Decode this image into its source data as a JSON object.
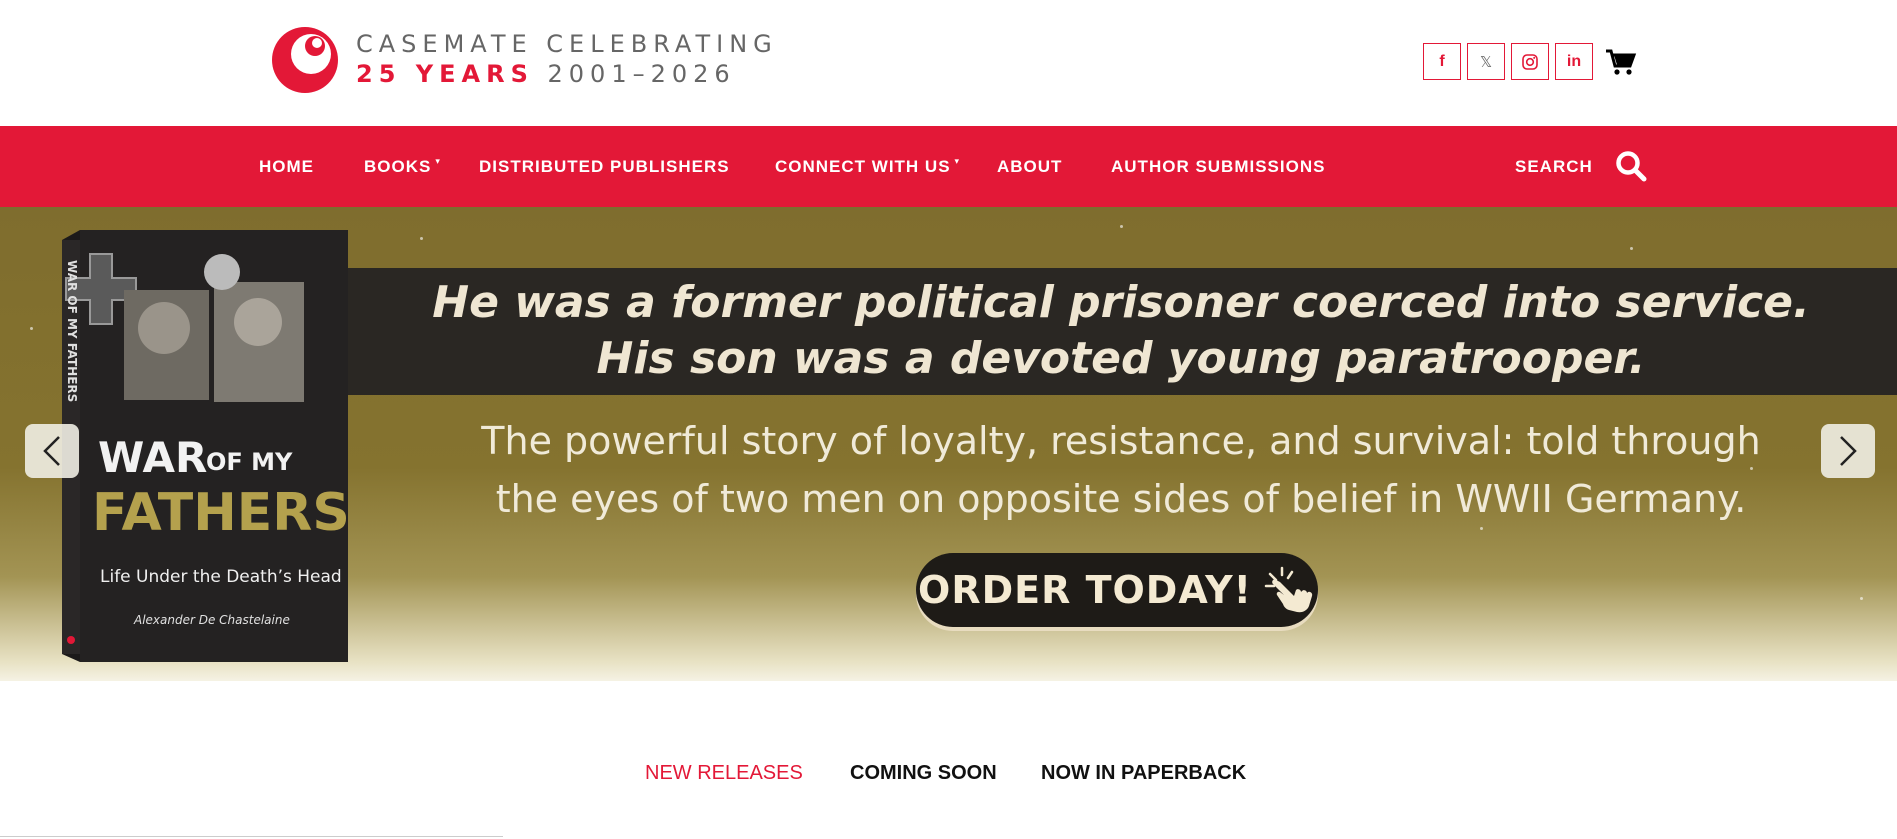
{
  "brand": {
    "line1": "CASEMATE CELEBRATING",
    "line2_accent": "25 YEARS",
    "line2_rest": "2001–2026",
    "accent_color": "#e31837"
  },
  "socials": [
    {
      "name": "facebook",
      "glyph": "f"
    },
    {
      "name": "x",
      "glyph": "𝕏"
    },
    {
      "name": "instagram",
      "glyph": "◎"
    },
    {
      "name": "linkedin",
      "glyph": "in"
    }
  ],
  "nav": {
    "items": [
      {
        "label": "HOME"
      },
      {
        "label": "BOOKS",
        "caret": "▾"
      },
      {
        "label": "DISTRIBUTED PUBLISHERS"
      },
      {
        "label": "CONNECT WITH US",
        "caret": "▾"
      },
      {
        "label": "ABOUT"
      },
      {
        "label": "AUTHOR SUBMISSIONS"
      }
    ],
    "search_label": "SEARCH"
  },
  "hero": {
    "headline_1": "He was a former political prisoner coerced into service.",
    "headline_2": "His son was a devoted young paratrooper.",
    "sub_1": "The powerful story of loyalty, resistance, and survival: told through",
    "sub_2": "the eyes of two men on opposite sides of belief in WWII Germany.",
    "cta": "ORDER TODAY!",
    "book": {
      "title_1": "WAR",
      "title_2": "OF MY",
      "title_3": "FATHERS",
      "subtitle": "Life Under the Death’s Head",
      "author": "Alexander De Chastelaine",
      "spine": "WAR OF MY FATHERS"
    }
  },
  "tabs": [
    {
      "label": "NEW RELEASES",
      "active": true
    },
    {
      "label": "COMING SOON",
      "active": false
    },
    {
      "label": "NOW IN PAPERBACK",
      "active": false
    }
  ]
}
